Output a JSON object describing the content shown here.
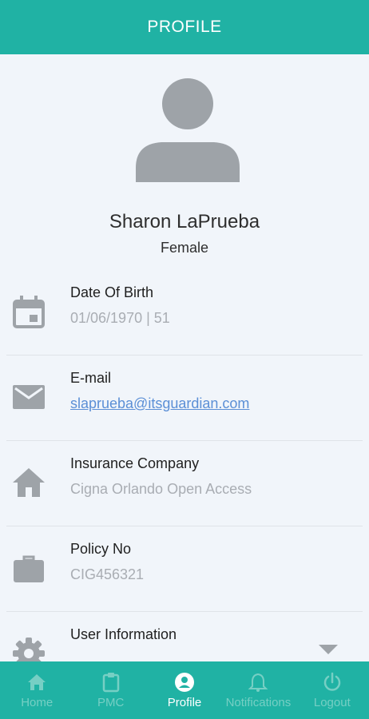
{
  "header": {
    "title": "PROFILE"
  },
  "profile": {
    "name": "Sharon LaPrueba",
    "gender": "Female"
  },
  "rows": [
    {
      "label": "Date Of Birth",
      "value": "01/06/1970 | 51",
      "icon": "calendar-icon"
    },
    {
      "label": "E-mail",
      "value": "slaprueba@itsguardian.com",
      "icon": "email-icon"
    },
    {
      "label": "Insurance Company",
      "value": "Cigna Orlando Open Access",
      "icon": "home-icon"
    },
    {
      "label": "Policy No",
      "value": "CIG456321",
      "icon": "briefcase-icon"
    },
    {
      "label": "User Information",
      "value": "",
      "icon": "gear-icon"
    }
  ],
  "nav": {
    "items": [
      {
        "label": "Home",
        "icon": "home-icon"
      },
      {
        "label": "PMC",
        "icon": "clipboard-icon"
      },
      {
        "label": "Profile",
        "icon": "profile-icon",
        "active": true
      },
      {
        "label": "Notifications",
        "icon": "bell-icon"
      },
      {
        "label": "Logout",
        "icon": "power-icon"
      }
    ]
  },
  "colors": {
    "brand": "#20b2a4",
    "nav_inactive": "#76cfc4",
    "icon_gray": "#9ea3a8",
    "link": "#5b8fd6"
  }
}
